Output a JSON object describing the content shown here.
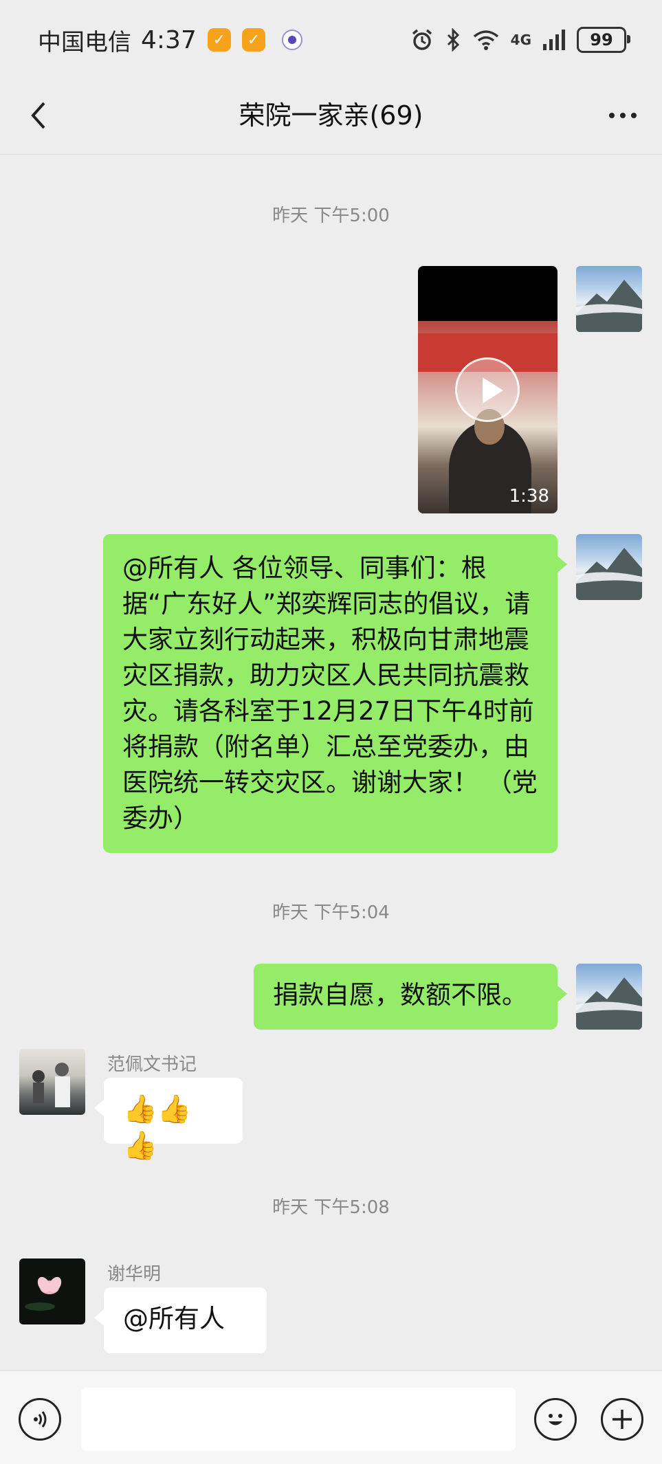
{
  "status_bar": {
    "carrier": "中国电信",
    "time": "4:37",
    "network": "4G",
    "battery": "99"
  },
  "header": {
    "title": "荣院一家亲(69)"
  },
  "messages": [
    {
      "type": "timestamp",
      "text": "昨天 下午5:00"
    },
    {
      "type": "video",
      "side": "me",
      "duration": "1:38"
    },
    {
      "type": "text",
      "side": "me",
      "text": "@所有人  各位领导、同事们：根据“广东好人”郑奕辉同志的倡议，请大家立刻行动起来，积极向甘肃地震灾区捐款，助力灾区人民共同抗震救灾。请各科室于12月27日下午4时前将捐款（附名单）汇总至党委办，由医院统一转交灾区。谢谢大家！ （党委办）"
    },
    {
      "type": "timestamp",
      "text": "昨天 下午5:04"
    },
    {
      "type": "text",
      "side": "me",
      "text": "捐款自愿，数额不限。"
    },
    {
      "type": "text",
      "side": "other",
      "sender": "范佩文书记",
      "text": "👍👍👍"
    },
    {
      "type": "timestamp",
      "text": "昨天 下午5:08"
    },
    {
      "type": "text",
      "side": "other",
      "sender": "谢华明",
      "text": "@所有人"
    }
  ],
  "input": {
    "value": "",
    "placeholder": ""
  },
  "colors": {
    "my_bubble": "#95ec69",
    "other_bubble": "#ffffff",
    "background": "#ededed"
  }
}
